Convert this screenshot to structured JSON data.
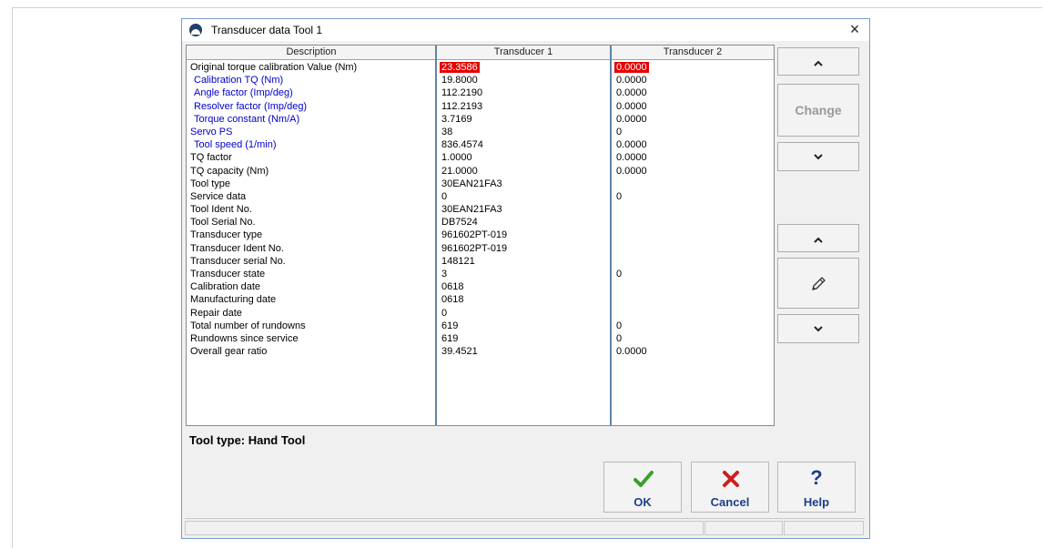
{
  "window": {
    "title": "Transducer data Tool 1",
    "close": "×"
  },
  "table": {
    "headers": [
      "Description",
      "Transducer 1",
      "Transducer 2"
    ],
    "rows": [
      {
        "desc": "Original torque calibration Value (Nm)",
        "t1": "23.3586",
        "t2": "0.0000",
        "blue": false,
        "indent": false,
        "highlight": true
      },
      {
        "desc": "Calibration TQ (Nm)",
        "t1": "19.8000",
        "t2": "0.0000",
        "blue": true,
        "indent": true
      },
      {
        "desc": "Angle factor (Imp/deg)",
        "t1": "112.2190",
        "t2": "0.0000",
        "blue": true,
        "indent": true
      },
      {
        "desc": "Resolver factor (Imp/deg)",
        "t1": "112.2193",
        "t2": "0.0000",
        "blue": true,
        "indent": true
      },
      {
        "desc": "Torque constant (Nm/A)",
        "t1": "3.7169",
        "t2": "0.0000",
        "blue": true,
        "indent": true
      },
      {
        "desc": "Servo PS",
        "t1": "38",
        "t2": "0",
        "blue": true,
        "indent": false
      },
      {
        "desc": "Tool speed (1/min)",
        "t1": "836.4574",
        "t2": "0.0000",
        "blue": true,
        "indent": true
      },
      {
        "desc": "TQ factor",
        "t1": "1.0000",
        "t2": "0.0000",
        "blue": false,
        "indent": false
      },
      {
        "desc": "TQ capacity (Nm)",
        "t1": "21.0000",
        "t2": "0.0000",
        "blue": false,
        "indent": false
      },
      {
        "desc": "Tool type",
        "t1": "30EAN21FA3",
        "t2": "",
        "blue": false,
        "indent": false
      },
      {
        "desc": "Service data",
        "t1": "0",
        "t2": "0",
        "blue": false,
        "indent": false
      },
      {
        "desc": "Tool Ident No.",
        "t1": "30EAN21FA3",
        "t2": "",
        "blue": false,
        "indent": false
      },
      {
        "desc": "Tool Serial No.",
        "t1": "DB7524",
        "t2": "",
        "blue": false,
        "indent": false
      },
      {
        "desc": "Transducer type",
        "t1": "961602PT-019",
        "t2": "",
        "blue": false,
        "indent": false
      },
      {
        "desc": "Transducer Ident No.",
        "t1": "961602PT-019",
        "t2": "",
        "blue": false,
        "indent": false
      },
      {
        "desc": "Transducer serial No.",
        "t1": "148121",
        "t2": "",
        "blue": false,
        "indent": false
      },
      {
        "desc": "Transducer state",
        "t1": "3",
        "t2": "0",
        "blue": false,
        "indent": false
      },
      {
        "desc": "Calibration date",
        "t1": "0618",
        "t2": "",
        "blue": false,
        "indent": false
      },
      {
        "desc": "Manufacturing date",
        "t1": "0618",
        "t2": "",
        "blue": false,
        "indent": false
      },
      {
        "desc": "Repair date",
        "t1": "0",
        "t2": "",
        "blue": false,
        "indent": false
      },
      {
        "desc": "Total number of rundowns",
        "t1": "619",
        "t2": "0",
        "blue": false,
        "indent": false
      },
      {
        "desc": "Rundowns since service",
        "t1": "619",
        "t2": "0",
        "blue": false,
        "indent": false
      },
      {
        "desc": "Overall gear ratio",
        "t1": "39.4521",
        "t2": "0.0000",
        "blue": false,
        "indent": false
      }
    ]
  },
  "tool_type_label": "Tool type: Hand Tool",
  "side_buttons": {
    "up_icon": "chevron-up-icon",
    "change": "Change",
    "down_icon": "chevron-down-icon",
    "edit_icon": "pencil-icon"
  },
  "bottom_buttons": {
    "ok": "OK",
    "cancel": "Cancel",
    "help": "Help"
  },
  "colors": {
    "accent_blue": "#0000cc",
    "highlight_red": "#e60000",
    "ok_green": "#3aa02a",
    "cancel_red": "#cc1f1f",
    "help_blue": "#1b3f8a"
  }
}
